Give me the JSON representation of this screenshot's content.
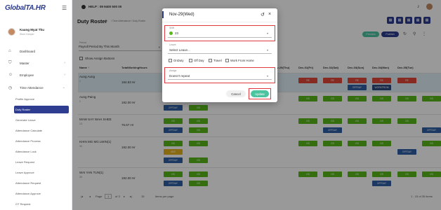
{
  "app": {
    "logo_prefix": "Global",
    "logo_suffix": "TA.HR",
    "help": "HELP : 09 9400 500 00"
  },
  "user": {
    "name": "Kaung Myat Thu",
    "role": "Store Keeper"
  },
  "nav": [
    {
      "label": "Dashboard",
      "icon": "home-icon",
      "has_children": false
    },
    {
      "label": "Master",
      "icon": "shield-icon",
      "has_children": true
    },
    {
      "label": "Employee",
      "icon": "users-icon",
      "has_children": true
    },
    {
      "label": "Time Attendance",
      "icon": "clock-icon",
      "has_children": true
    }
  ],
  "sub_nav": [
    "Profile Approve",
    "Duty Roster",
    "Generate Leave",
    "Attendance Calculate",
    "Attendance Process",
    "Attendance Lock",
    "Leave Request",
    "Leave Approve",
    "Attendance Request",
    "Attendance Approve",
    "OT Request"
  ],
  "active_sub": "Duty Roster",
  "page": {
    "title": "Duty Roster",
    "breadcrumb": "/ Time Attendance / Duty Roster"
  },
  "toolbar": {
    "preview": "Preview",
    "publish": "Publish"
  },
  "period": {
    "label": "Period",
    "value": "Payroll Period By This Month"
  },
  "show_assign": "Show Assign Buttons",
  "grid": {
    "headers": [
      "Name ↑",
      "TotalWorkingHours",
      "Nov-29(Thu)",
      "Dec-01(Fri)",
      "Dec-02(Sat)",
      "Dec-03(Sun)",
      "Dec-04(Mon)",
      "Dec-05(Tue)"
    ],
    "rows": [
      {
        "name": "Aung Aung",
        "id": "1",
        "hours": "184.83 Hr"
      },
      {
        "name": "Aung Paing",
        "id": "2",
        "hours": "192.00 Hr"
      },
      {
        "name": "MAW SAY WAH SHEE",
        "id": "13",
        "hours": "76.67 Hr"
      },
      {
        "name": "KHIN MG MG LWIN(1)",
        "id": "34",
        "hours": "192.00 Hr"
      },
      {
        "name": "WAI YAN TUN(1)",
        "id": "35",
        "hours": "192.00 Hr"
      }
    ],
    "cell_texts": {
      "off": "OFFDAY",
      "wo": "WORKFROM",
      "re": "RE",
      "gs": "GS",
      "ab": "ABS"
    }
  },
  "pager": {
    "page_label": "Page",
    "page_value": "1",
    "of_text": "of 3",
    "size": "15",
    "items_label": "items per page",
    "range": "1 - 15 of 35 items"
  },
  "modal": {
    "title": "Nov-29(Wed)",
    "shift_label": "Shift",
    "shift_value": "23",
    "leave_label": "Leave",
    "leave_placeholder": "Select Leave...",
    "options": [
      "OnDuty",
      "Off Day",
      "Travel",
      "Work From Home"
    ],
    "assign_label": "Assign",
    "assign_value": "Doesn't repeat",
    "cancel": "Cancel",
    "update": "Update"
  },
  "colors": {
    "primary": "#2e3d8f",
    "accent": "#4cc4a0",
    "highlight": "#e0393e"
  }
}
